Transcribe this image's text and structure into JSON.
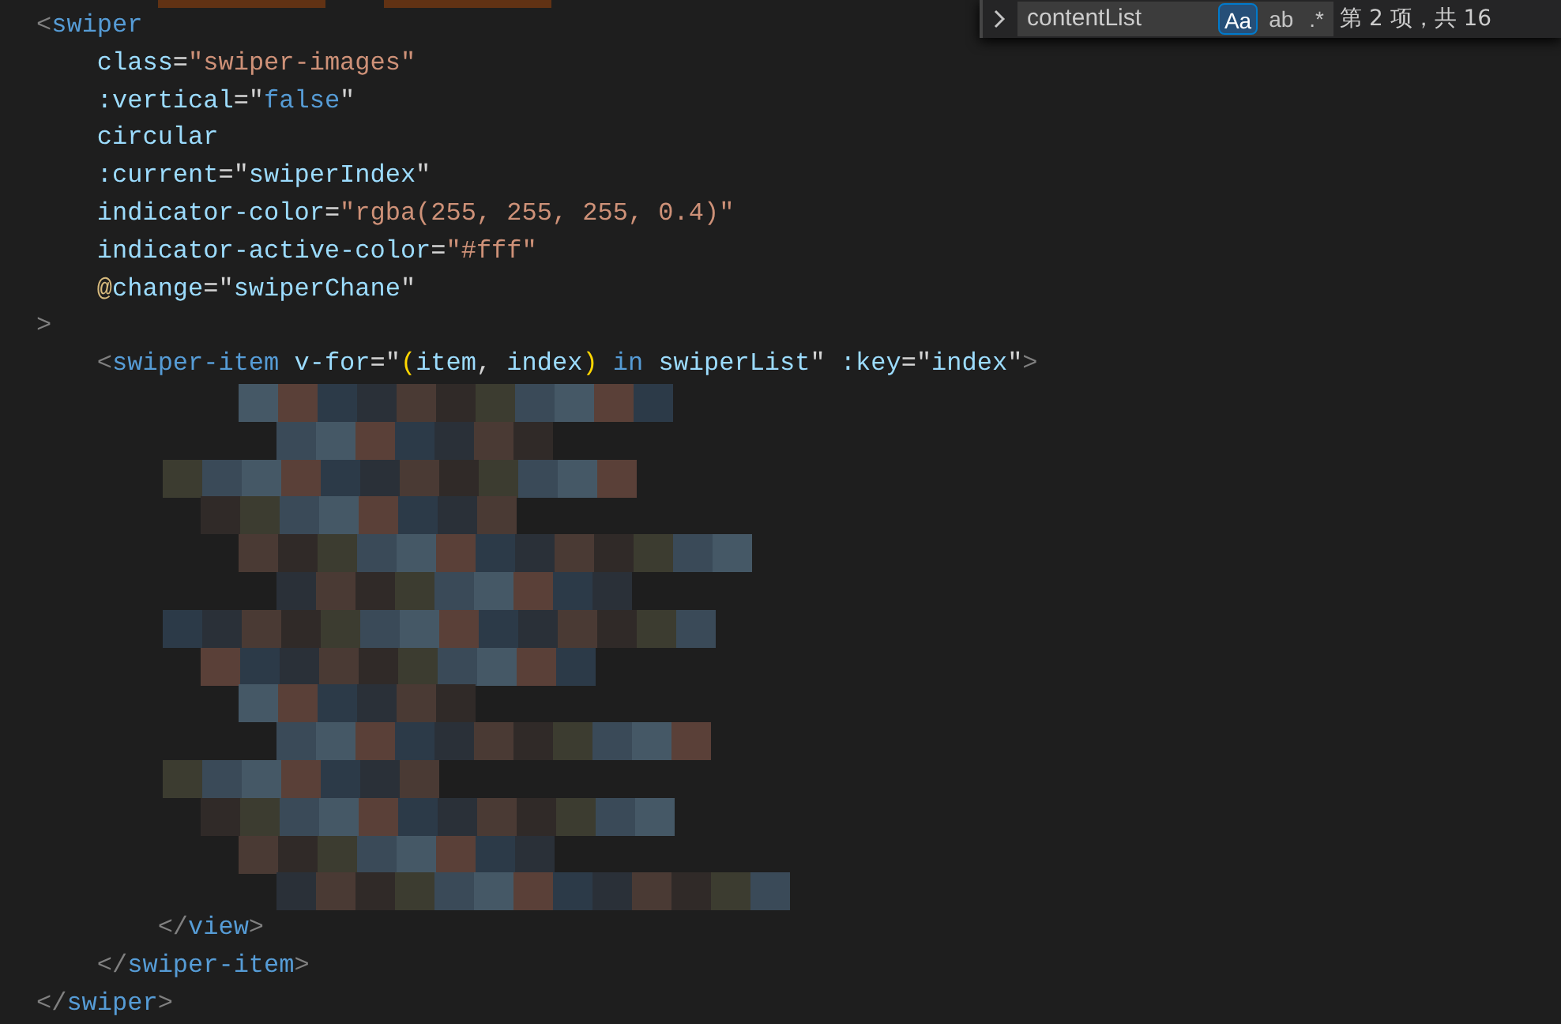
{
  "find_widget": {
    "query": "contentList",
    "options": [
      {
        "label": "Aa",
        "selected": true
      },
      {
        "label": "ab",
        "selected": false
      },
      {
        "label": ".*",
        "selected": false
      }
    ],
    "result": "第 2 项，共 16"
  },
  "code_lines": [
    {
      "kind": "code",
      "tokens": [
        {
          "kind": "bracket",
          "s": "<"
        },
        {
          "kind": "tag",
          "s": "swiper"
        }
      ]
    },
    {
      "kind": "code",
      "tokens": [
        {
          "kind": "attr",
          "s": "    class"
        },
        {
          "kind": "punct",
          "s": "="
        },
        {
          "kind": "string",
          "s": "\"swiper-images\""
        }
      ]
    },
    {
      "kind": "code",
      "tokens": [
        {
          "kind": "attr",
          "s": "    :vertical"
        },
        {
          "kind": "punct",
          "s": "=\""
        },
        {
          "kind": "keyword",
          "s": "false"
        },
        {
          "kind": "punct",
          "s": "\""
        }
      ]
    },
    {
      "kind": "code",
      "tokens": [
        {
          "kind": "attr",
          "s": "    circular"
        }
      ]
    },
    {
      "kind": "code",
      "tokens": [
        {
          "kind": "attr",
          "s": "    :current"
        },
        {
          "kind": "punct",
          "s": "=\""
        },
        {
          "kind": "attr",
          "s": "swiperIndex"
        },
        {
          "kind": "punct",
          "s": "\""
        }
      ]
    },
    {
      "kind": "code",
      "tokens": [
        {
          "kind": "attr",
          "s": "    indicator-color"
        },
        {
          "kind": "punct",
          "s": "="
        },
        {
          "kind": "string",
          "s": "\"rgba(255, 255, 255, 0.4)\""
        }
      ]
    },
    {
      "kind": "code",
      "tokens": [
        {
          "kind": "attr",
          "s": "    indicator-active-color"
        },
        {
          "kind": "punct",
          "s": "="
        },
        {
          "kind": "string",
          "s": "\"#fff\""
        }
      ]
    },
    {
      "kind": "code",
      "tokens": [
        {
          "kind": "at",
          "s": "    @"
        },
        {
          "kind": "attr",
          "s": "change"
        },
        {
          "kind": "punct",
          "s": "=\""
        },
        {
          "kind": "attr",
          "s": "swiperChane"
        },
        {
          "kind": "punct",
          "s": "\""
        }
      ]
    },
    {
      "kind": "code",
      "tokens": [
        {
          "kind": "bracket",
          "s": ">"
        }
      ]
    },
    {
      "kind": "code",
      "tokens": [
        {
          "kind": "bracket",
          "s": "    <"
        },
        {
          "kind": "tag",
          "s": "swiper-item"
        },
        {
          "kind": "attr",
          "s": " v-for"
        },
        {
          "kind": "punct",
          "s": "=\""
        },
        {
          "kind": "paren",
          "s": "("
        },
        {
          "kind": "attr",
          "s": "item"
        },
        {
          "kind": "punct",
          "s": ", "
        },
        {
          "kind": "attr",
          "s": "index"
        },
        {
          "kind": "paren",
          "s": ")"
        },
        {
          "kind": "keyword",
          "s": " in "
        },
        {
          "kind": "attr",
          "s": "swiperList"
        },
        {
          "kind": "punct",
          "s": "\""
        },
        {
          "kind": "attr",
          "s": " :key"
        },
        {
          "kind": "punct",
          "s": "=\""
        },
        {
          "kind": "attr",
          "s": "index"
        },
        {
          "kind": "punct",
          "s": "\""
        },
        {
          "kind": "bracket",
          "s": ">"
        }
      ]
    },
    {
      "kind": "redacted"
    },
    {
      "kind": "redacted"
    },
    {
      "kind": "redacted"
    },
    {
      "kind": "redacted"
    },
    {
      "kind": "redacted"
    },
    {
      "kind": "redacted"
    },
    {
      "kind": "redacted"
    },
    {
      "kind": "redacted"
    },
    {
      "kind": "redacted"
    },
    {
      "kind": "redacted"
    },
    {
      "kind": "redacted"
    },
    {
      "kind": "redacted"
    },
    {
      "kind": "redacted"
    },
    {
      "kind": "redacted"
    },
    {
      "kind": "code",
      "tokens": [
        {
          "kind": "bracket",
          "s": "        </"
        },
        {
          "kind": "tag",
          "s": "view"
        },
        {
          "kind": "bracket",
          "s": ">"
        }
      ]
    },
    {
      "kind": "code",
      "tokens": [
        {
          "kind": "bracket",
          "s": "    </"
        },
        {
          "kind": "tag",
          "s": "swiper-item"
        },
        {
          "kind": "bracket",
          "s": ">"
        }
      ]
    },
    {
      "kind": "code",
      "tokens": [
        {
          "kind": "bracket",
          "s": "</"
        },
        {
          "kind": "tag",
          "s": "swiper"
        },
        {
          "kind": "bracket",
          "s": ">"
        }
      ]
    }
  ]
}
